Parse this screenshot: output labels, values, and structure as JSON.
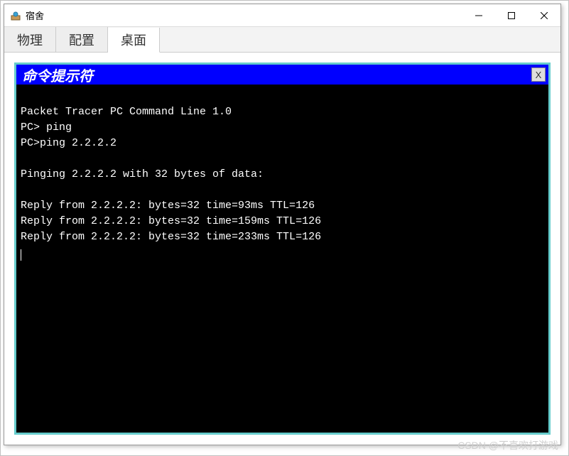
{
  "window": {
    "title": "宿舍",
    "controls": {
      "min": "—",
      "max": "☐",
      "close": "✕"
    }
  },
  "tabs": {
    "items": [
      "物理",
      "配置",
      "桌面"
    ],
    "active_index": 2
  },
  "terminal": {
    "title": "命令提示符",
    "close": "X",
    "lines": [
      "Packet Tracer PC Command Line 1.0",
      "PC> ping",
      "PC>ping 2.2.2.2",
      "",
      "Pinging 2.2.2.2 with 32 bytes of data:",
      "",
      "Reply from 2.2.2.2: bytes=32 time=93ms TTL=126",
      "Reply from 2.2.2.2: bytes=32 time=159ms TTL=126",
      "Reply from 2.2.2.2: bytes=32 time=233ms TTL=126"
    ]
  },
  "watermark": "CSDN @不喜欢打游戏"
}
